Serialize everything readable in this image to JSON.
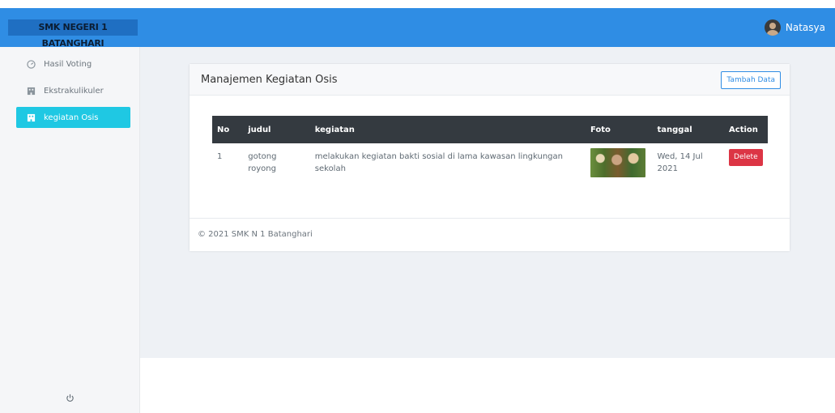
{
  "header": {
    "brand": "SMK NEGERI 1 BATANGHARI",
    "user_name": "Natasya"
  },
  "sidebar": {
    "items": [
      {
        "label": "Hasil Voting",
        "icon": "gauge-icon",
        "active": false
      },
      {
        "label": "Ekstrakulikuler",
        "icon": "building-icon",
        "active": false
      },
      {
        "label": "kegiatan Osis",
        "icon": "building-icon",
        "active": true
      }
    ],
    "power_icon": "power-icon"
  },
  "card": {
    "title": "Manajemen Kegiatan Osis",
    "add_button": "Tambah Data",
    "footer": "© 2021 SMK N 1 Batanghari"
  },
  "table": {
    "headers": [
      "No",
      "judul",
      "kegiatan",
      "Foto",
      "tanggal",
      "Action"
    ],
    "rows": [
      {
        "no": "1",
        "judul": "gotong royong",
        "kegiatan": "melakukan kegiatan bakti sosial di lama kawasan lingkungan sekolah",
        "tanggal": "Wed, 14 Jul 2021",
        "action": "Delete"
      }
    ]
  },
  "colors": {
    "topbar": "#2f8de4",
    "active_item": "#1fc8e3",
    "table_header": "#343a40",
    "delete": "#dc3545"
  }
}
